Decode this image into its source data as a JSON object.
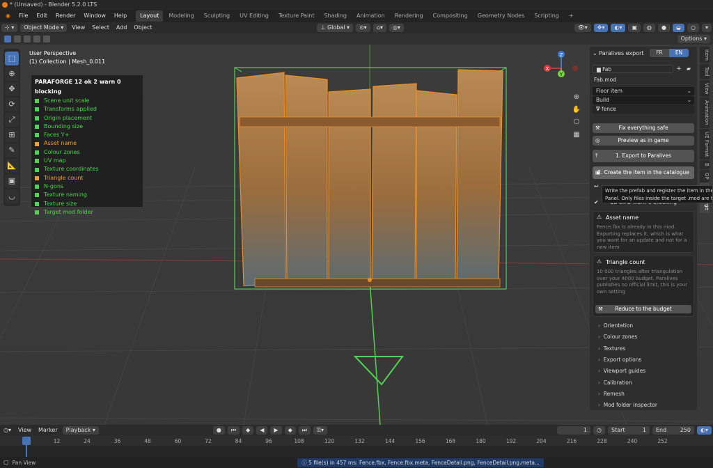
{
  "window": {
    "title": "* (Unsaved) - Blender 5.2.0 LTS"
  },
  "menu": [
    "File",
    "Edit",
    "Render",
    "Window",
    "Help"
  ],
  "workspaces": [
    "Layout",
    "Modeling",
    "Sculpting",
    "UV Editing",
    "Texture Paint",
    "Shading",
    "Animation",
    "Rendering",
    "Compositing",
    "Geometry Nodes",
    "Scripting"
  ],
  "workspace_add": "+",
  "viewport_header": {
    "mode": "Object Mode",
    "menus": [
      "View",
      "Select",
      "Add",
      "Object"
    ],
    "orientation": "Global",
    "options": "Options"
  },
  "viewport": {
    "perspective": "User Perspective",
    "collection": "(1) Collection | Mesh_0.011"
  },
  "gizmo": {
    "x": "X",
    "y": "Y",
    "z": "Z"
  },
  "paraforge": {
    "title": "PARAFORGE  12 ok  2 warn  0 blocking",
    "checks": [
      {
        "label": "Scene unit scale",
        "status": "ok"
      },
      {
        "label": "Transforms applied",
        "status": "ok"
      },
      {
        "label": "Origin placement",
        "status": "ok"
      },
      {
        "label": "Bounding size",
        "status": "ok"
      },
      {
        "label": "Faces Y+",
        "status": "ok"
      },
      {
        "label": "Asset name",
        "status": "warn"
      },
      {
        "label": "Colour zones",
        "status": "ok"
      },
      {
        "label": "UV map",
        "status": "ok"
      },
      {
        "label": "Texture coordinates",
        "status": "ok"
      },
      {
        "label": "Triangle count",
        "status": "warn"
      },
      {
        "label": "N-gons",
        "status": "ok"
      },
      {
        "label": "Texture naming",
        "status": "ok"
      },
      {
        "label": "Texture size",
        "status": "ok"
      },
      {
        "label": "Target mod folder",
        "status": "ok"
      }
    ]
  },
  "colors": {
    "ok": "#4fd44f",
    "warn": "#f0a030",
    "accent": "#4772b3",
    "selection": "#e8902a",
    "bbox": "#5ce85c"
  },
  "npanel": {
    "header": "Paralives export",
    "lang_fr": "FR",
    "lang_en": "EN",
    "library": "Fab",
    "mod": "Fab.mod",
    "category": "Floor item",
    "subcategory": "Build",
    "name": "fence",
    "btn_fix": "Fix everything safe",
    "btn_preview": "Preview as in game",
    "btn_export": "1.  Export to Paralives",
    "btn_create": "2.  Create the item in the catalogue",
    "summary": "12 ok  2 warn  0 blocking",
    "warn1_title": "Asset name",
    "warn1_body": "Fence.fbx is already in this mod. Exporting replaces it, which is what you want for an update and not for a new item",
    "warn2_title": "Triangle count",
    "warn2_body": "10 000 triangles after triangulation over your 4000 budget. Paralives publishes no official limit, this is your own setting",
    "btn_reduce": "Reduce to the budget",
    "sections": [
      "Orientation",
      "Colour zones",
      "Textures",
      "Export options",
      "Viewport guides",
      "Calibration",
      "Remesh",
      "Mod folder inspector"
    ]
  },
  "tooltip": {
    "line1": "Write the prefab and register the item in the m",
    "line2": "Panel. Only files inside the target .mod are tou"
  },
  "side_tabs": [
    "Item",
    "Tool",
    "View",
    "Animation",
    "UE Format",
    "B",
    "GP",
    "ParaForge"
  ],
  "timeline": {
    "menus": [
      "View",
      "Marker",
      "Playback"
    ],
    "current": "1",
    "start_label": "Start",
    "start": "1",
    "end_label": "End",
    "end": "250",
    "ticks": [
      "1",
      "12",
      "24",
      "36",
      "48",
      "60",
      "72",
      "84",
      "96",
      "108",
      "120",
      "132",
      "144",
      "156",
      "168",
      "180",
      "192",
      "204",
      "216",
      "228",
      "240",
      "252"
    ]
  },
  "status": {
    "left": "Pan View",
    "message": "5 file(s) in 457 ms: Fence.fbx, Fence.fbx.meta, FenceDetail.png, FenceDetail.png.meta..."
  }
}
